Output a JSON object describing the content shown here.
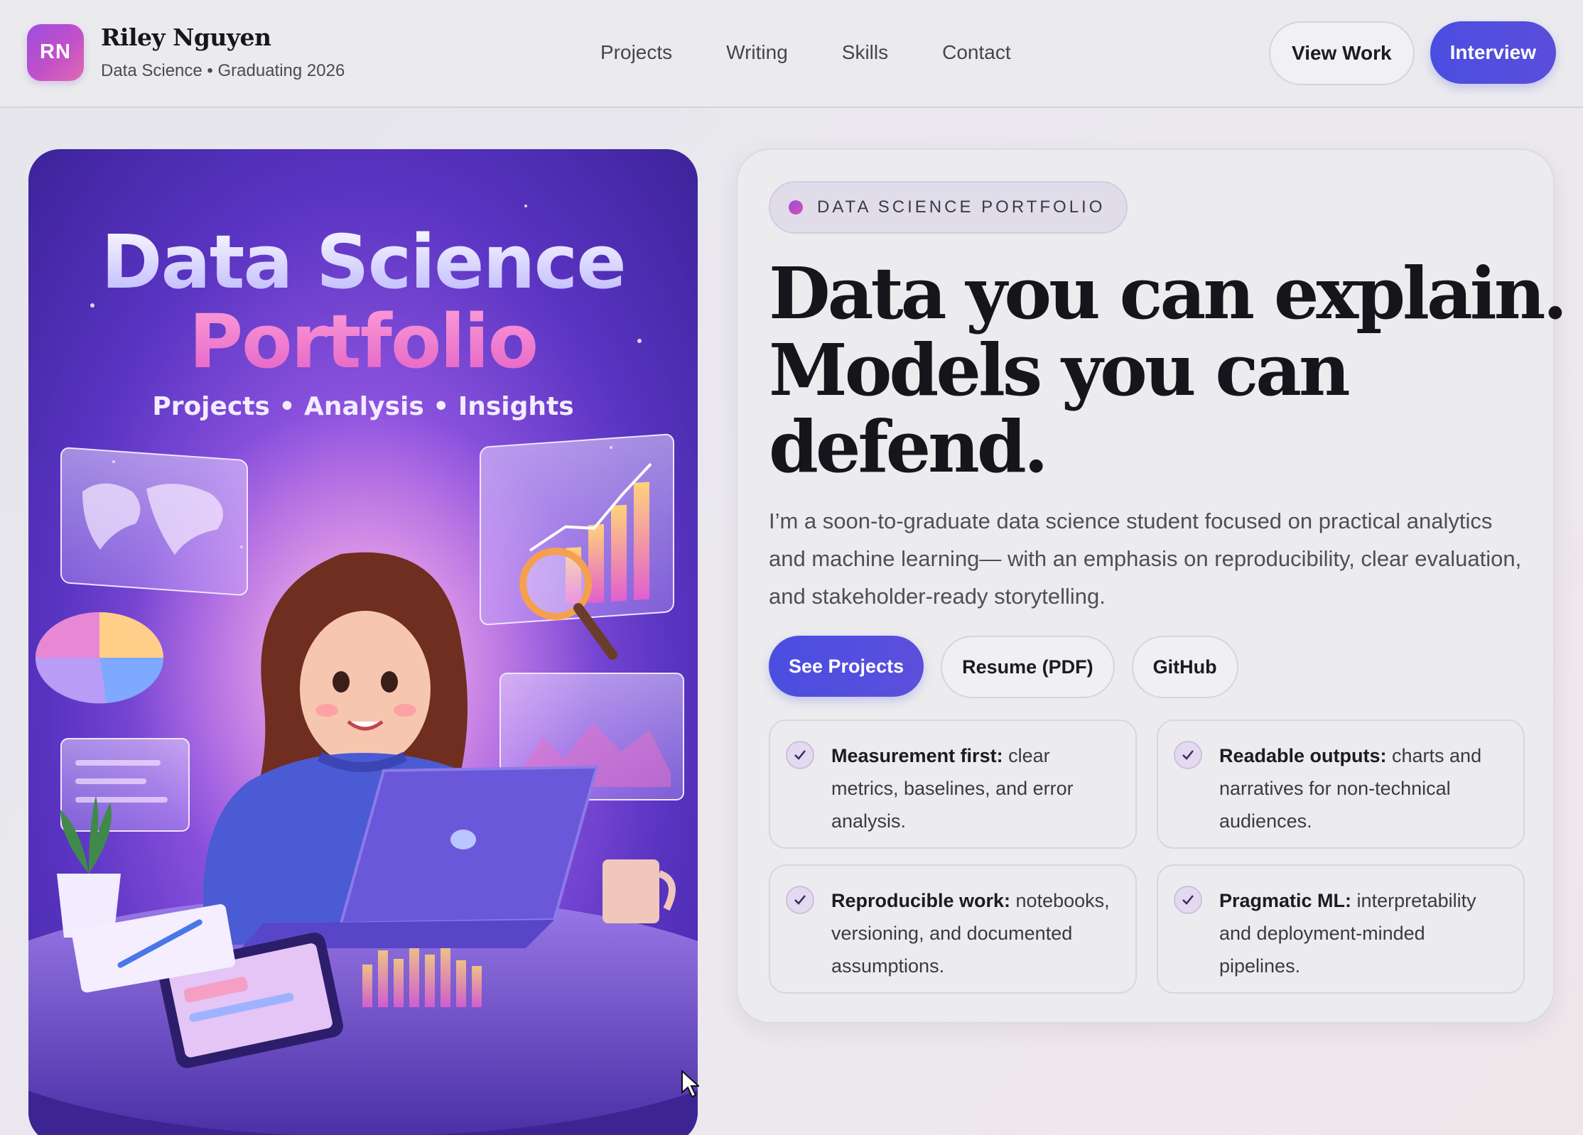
{
  "header": {
    "avatar_initials": "RN",
    "name": "Riley Nguyen",
    "subtitle": "Data Science • Graduating 2026",
    "nav": [
      "Projects",
      "Writing",
      "Skills",
      "Contact"
    ],
    "view_work_label": "View Work",
    "interview_label": "Interview"
  },
  "poster": {
    "title_line1": "Data Science",
    "title_line2": "Portfolio",
    "tagline": "Projects • Analysis • Insights"
  },
  "hero": {
    "badge": "DATA SCIENCE PORTFOLIO",
    "headline": [
      "Data you can explain.",
      "Models you can",
      "defend."
    ],
    "lede": "I’m a soon-to-graduate data science student focused on practical analytics and machine learning— with an emphasis on reproducibility, clear evaluation, and stakeholder-ready storytelling.",
    "cta_primary": "See Projects",
    "cta_resume": "Resume (PDF)",
    "cta_github": "GitHub"
  },
  "features": [
    {
      "title": "Measurement first:",
      "text": " clear metrics, baselines, and error analysis."
    },
    {
      "title": "Readable outputs:",
      "text": " charts and narratives for non-technical audiences."
    },
    {
      "title": "Reproducible work:",
      "text": " notebooks, versioning, and documented assumptions."
    },
    {
      "title": "Pragmatic ML:",
      "text": " interpretability and deployment-minded pipelines."
    }
  ],
  "colors": {
    "accent": "#4a4ee0",
    "avatar_gradient_start": "#9d4de0",
    "avatar_gradient_end": "#e06bb1"
  },
  "icons": {
    "check": "check-icon",
    "cursor": "mouse-pointer-icon"
  }
}
